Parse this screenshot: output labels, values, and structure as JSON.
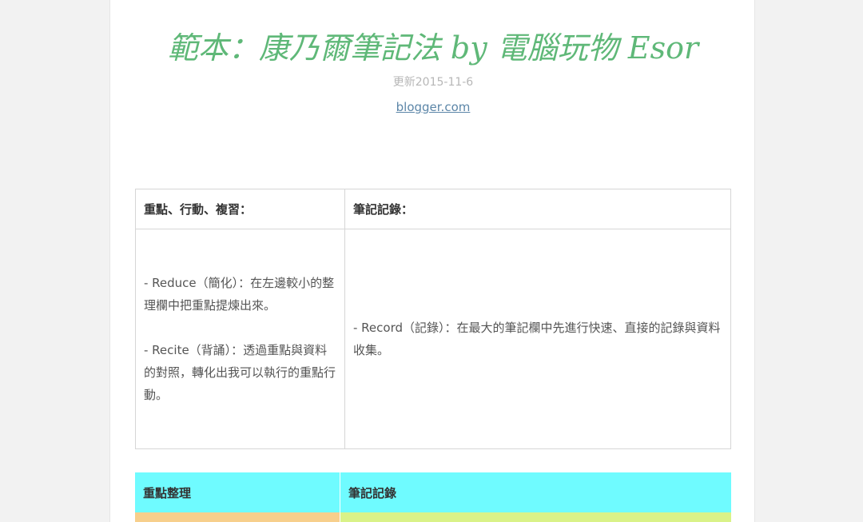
{
  "doc": {
    "title": "範本：康乃爾筆記法 by 電腦玩物 Esor",
    "updated": "更新2015-11-6",
    "source_link": "blogger.com"
  },
  "table1": {
    "header_left": "重點、行動、複習：",
    "header_right": "筆記記錄：",
    "left_para1": "- Reduce（簡化）：在左邊較小的整理欄中把重點提煉出來。",
    "left_para2": "- Recite（背誦）：透過重點與資料的對照，轉化出我可以執行的重點行動。",
    "right_para": "- Record（記錄）：在最大的筆記欄中先進行快速、直接的記錄與資料收集。"
  },
  "table2": {
    "header_left": "重點整理",
    "header_right": "筆記記錄",
    "colors": {
      "header_bg": "#6ffbff",
      "row_left_bg": "#f7cf8c",
      "row_right_bg": "#d9f288"
    }
  },
  "colors": {
    "title": "#5fb878",
    "link": "#5c86a8"
  }
}
